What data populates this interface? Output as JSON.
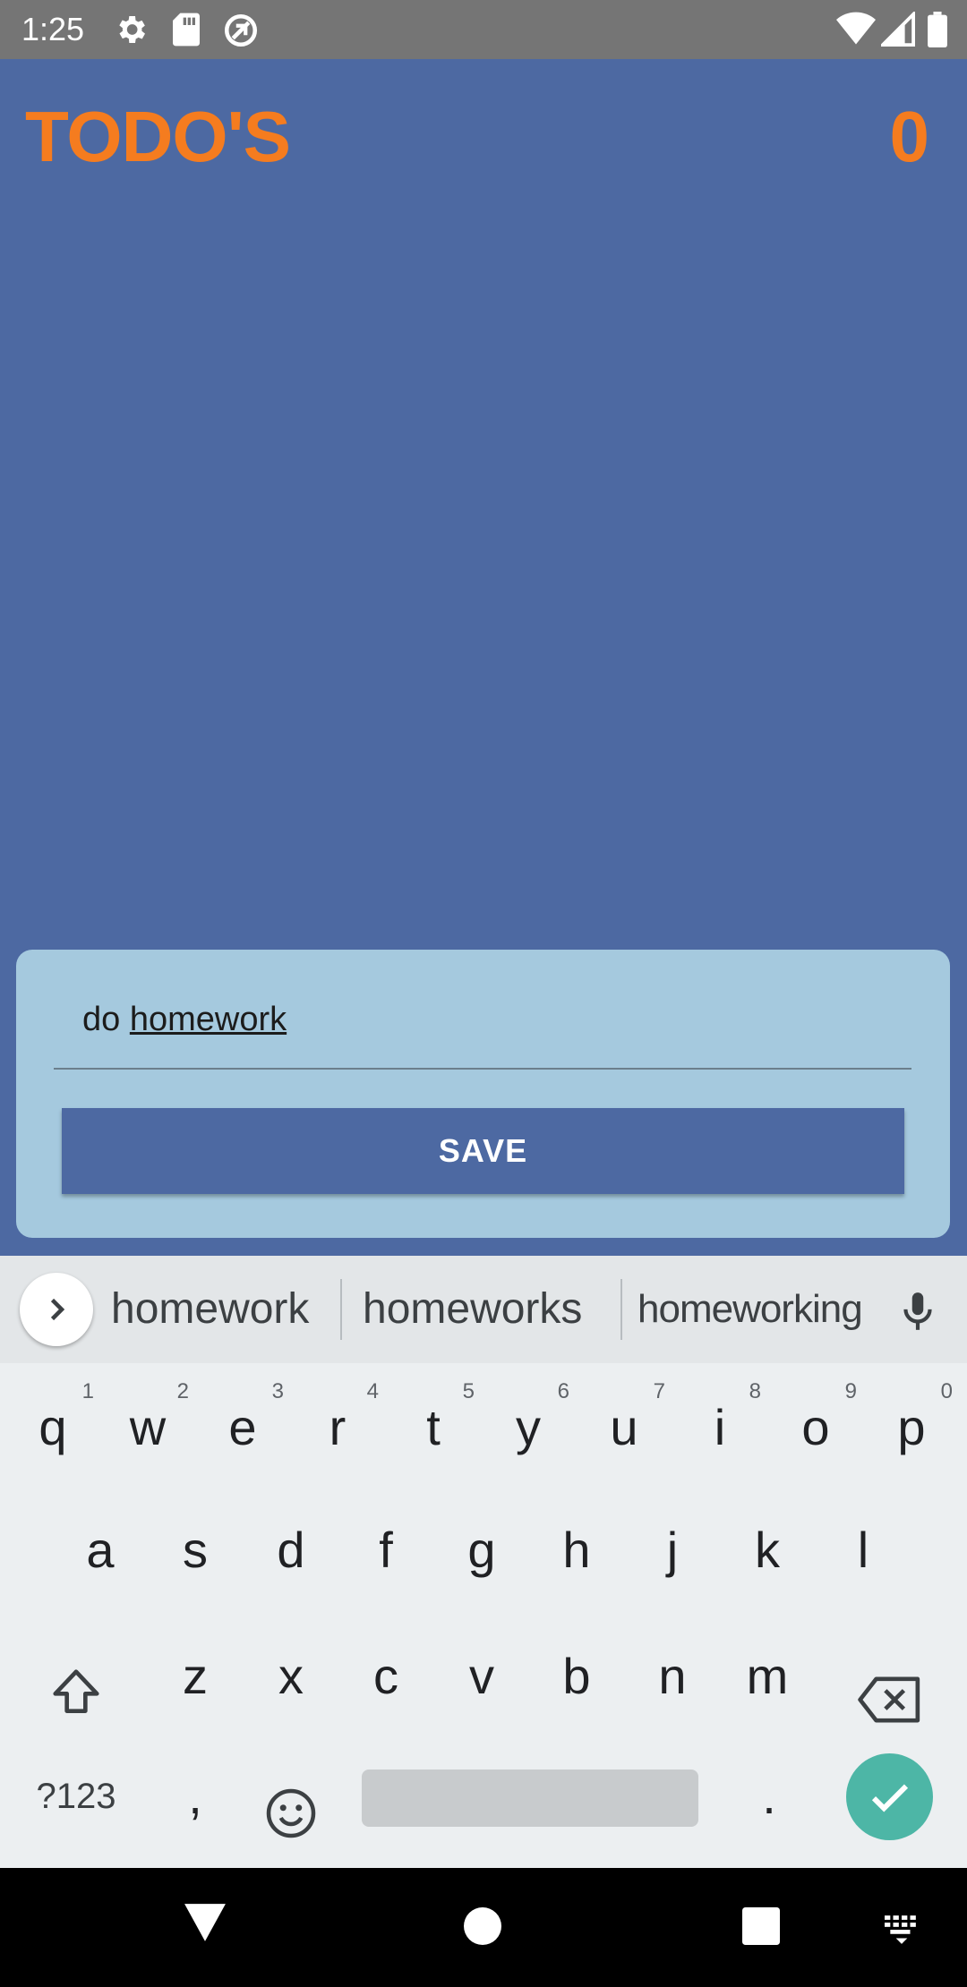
{
  "status_bar": {
    "time": "1:25",
    "left_icons": [
      "gear-icon",
      "sd-card-icon",
      "data-saver-icon"
    ],
    "right_icons": [
      "wifi-icon",
      "signal-icon",
      "battery-icon"
    ]
  },
  "header": {
    "title": "TODO'S",
    "count": "0",
    "accent_color": "#f57c1f",
    "background_color": "#4d69a2"
  },
  "form": {
    "input_value_plain": "do",
    "input_value_underlined": "homework",
    "save_label": "SAVE"
  },
  "keyboard": {
    "suggestions": [
      "homework",
      "homeworks",
      "homeworking"
    ],
    "row1": [
      {
        "key": "q",
        "hint": "1"
      },
      {
        "key": "w",
        "hint": "2"
      },
      {
        "key": "e",
        "hint": "3"
      },
      {
        "key": "r",
        "hint": "4"
      },
      {
        "key": "t",
        "hint": "5"
      },
      {
        "key": "y",
        "hint": "6"
      },
      {
        "key": "u",
        "hint": "7"
      },
      {
        "key": "i",
        "hint": "8"
      },
      {
        "key": "o",
        "hint": "9"
      },
      {
        "key": "p",
        "hint": "0"
      }
    ],
    "row2": [
      "a",
      "s",
      "d",
      "f",
      "g",
      "h",
      "j",
      "k",
      "l"
    ],
    "row3": [
      "z",
      "x",
      "c",
      "v",
      "b",
      "n",
      "m"
    ],
    "symbols_label": "?123",
    "comma": ",",
    "period": "."
  },
  "nav_bar": {
    "icons": [
      "back-icon",
      "home-icon",
      "recents-icon",
      "keyboard-switch-icon"
    ]
  }
}
